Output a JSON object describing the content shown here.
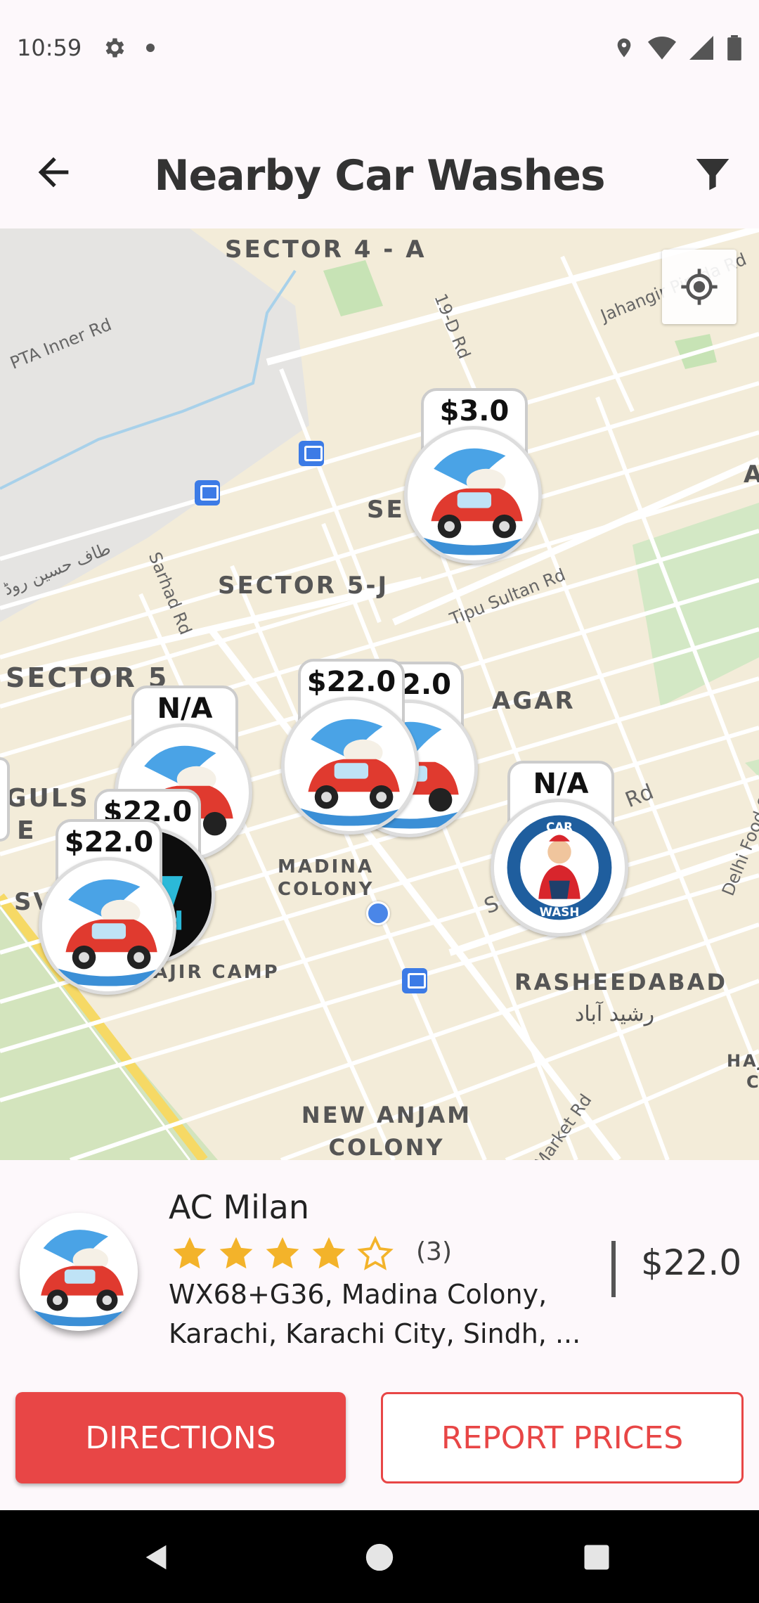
{
  "status_bar": {
    "time": "10:59"
  },
  "header": {
    "title": "Nearby Car Washes"
  },
  "map": {
    "area_labels": [
      "SECTOR 4 - A",
      "SECTOR 5-J",
      "SECTOR 5",
      "MADINA COLONY",
      "RASHEEDABAD",
      "رشید آباد",
      "NEW ANJAM COLONY",
      "AJIR CAMP",
      "AGAR",
      "SE",
      "GULS",
      "E",
      "SV",
      "A",
      "HAJ",
      "C"
    ],
    "road_labels": [
      "PTA Inner Rd",
      "19-D Rd",
      "Jahangir Pirada Rd",
      "Sarhad Rd",
      "Tipu Sultan Rd",
      "طاف حسین روڈ",
      "Delhi Food St",
      "Market Rd",
      "Rd",
      "S"
    ],
    "markers": [
      {
        "price": "$3.0",
        "logo": "red-car-wash-logo"
      },
      {
        "price": "$22.0",
        "logo": "red-car-wash-logo"
      },
      {
        "price": "2.0",
        "logo": "red-car-wash-logo"
      },
      {
        "price": "N/A",
        "logo": "red-car-wash-logo"
      },
      {
        "price": "$22.0",
        "logo": "black-car-wash-logo"
      },
      {
        "price": "$22.0",
        "logo": "red-car-wash-logo"
      },
      {
        "price": "N/A",
        "logo": "blue-car-wash-logo"
      }
    ],
    "blue_logo_text_top": "CAR",
    "blue_logo_text_bottom": "WASH",
    "black_logo_text": "H"
  },
  "selected": {
    "name": "AC Milan",
    "rating": 4,
    "rating_max": 5,
    "rating_count": "(3)",
    "address": "WX68+G36, Madina Colony, Karachi, Karachi City, Sindh, ...",
    "price": "$22.0"
  },
  "buttons": {
    "directions": "DIRECTIONS",
    "report": "REPORT PRICES"
  },
  "colors": {
    "accent": "#e84646",
    "star": "#f3b32a",
    "location": "#4a86e8"
  }
}
